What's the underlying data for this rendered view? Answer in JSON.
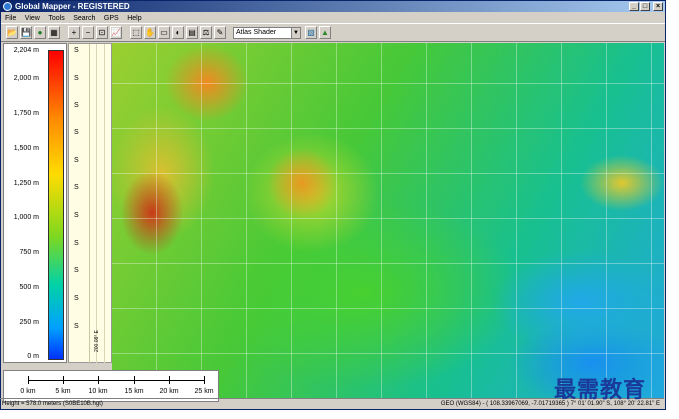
{
  "window": {
    "title": "Global Mapper - REGISTERED"
  },
  "menu": [
    "File",
    "View",
    "Tools",
    "Search",
    "GPS",
    "Help"
  ],
  "toolbar": {
    "shader_value": "Atlas Shader",
    "shader_arrow": "▼",
    "icons": [
      "open-icon",
      "save-icon",
      "globe-icon",
      "config-icon",
      "zoom-in-icon",
      "zoom-out-icon",
      "zoom-box-icon",
      "chart-icon",
      "select-icon",
      "pan-icon",
      "measure-icon",
      "map-icon",
      "layers-icon",
      "path-icon",
      "tool-icon",
      "shader-icon",
      "terrain-icon"
    ],
    "glyphs": [
      "📂",
      "💾",
      "●",
      "▦",
      "+",
      "−",
      "⊡",
      "📈",
      "⬚",
      "✋",
      "▭",
      "◐",
      "▤",
      "⚖",
      "✎",
      "▧",
      "▲"
    ]
  },
  "legend": {
    "labels": [
      "2,204 m",
      "2,000 m",
      "1,750 m",
      "1,500 m",
      "1,250 m",
      "1,000 m",
      "750 m",
      "500 m",
      "250 m",
      "0 m"
    ]
  },
  "ruler": {
    "s_labels": [
      "S",
      "S",
      "S",
      "S",
      "S",
      "S",
      "S",
      "S",
      "S",
      "S",
      "S"
    ],
    "rotated": [
      "200.08° E"
    ]
  },
  "scale": {
    "labels": [
      "0 km",
      "5 km",
      "10 km",
      "15 km",
      "20 km",
      "25 km"
    ]
  },
  "status": {
    "left": "Height = 578.0 meters (S0BE10B.hgt)",
    "right": "GEO (WGS84) - ( 108.33967069, -7.01719365 ) 7° 01' 01.90\" S, 108° 20' 22.81\" E"
  },
  "watermark": "最需教育",
  "window_buttons": [
    "_",
    "□",
    "×"
  ]
}
